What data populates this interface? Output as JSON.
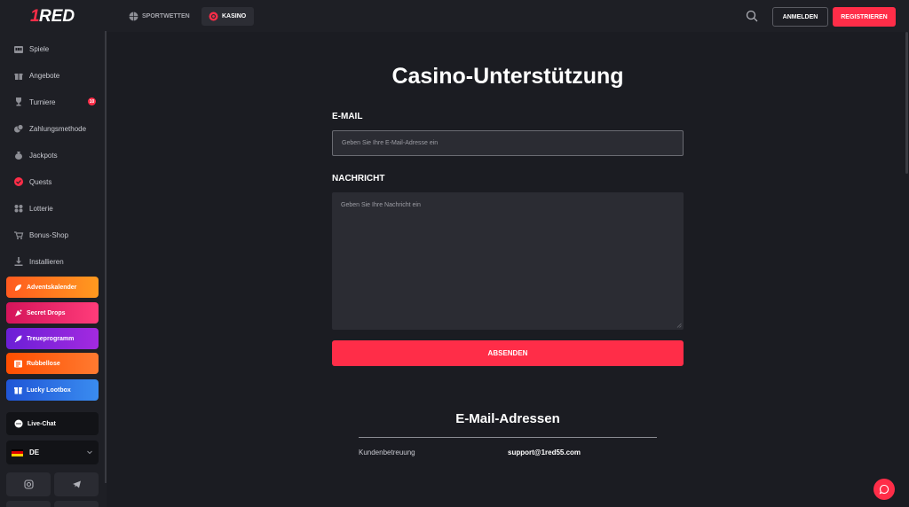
{
  "brand": {
    "logo_text": "1RED",
    "accent": "#ff2d48"
  },
  "sidebar": {
    "items": [
      {
        "label": "Spiele",
        "icon": "slots-icon"
      },
      {
        "label": "Angebote",
        "icon": "gift-icon"
      },
      {
        "label": "Turniere",
        "icon": "trophy-icon",
        "badge": "10"
      },
      {
        "label": "Zahlungsmethode",
        "icon": "coins-icon"
      },
      {
        "label": "Jackpots",
        "icon": "money-bag-icon"
      },
      {
        "label": "Quests",
        "icon": "quests-icon"
      },
      {
        "label": "Lotterie",
        "icon": "lottery-icon"
      },
      {
        "label": "Bonus-Shop",
        "icon": "shop-icon"
      },
      {
        "label": "Installieren",
        "icon": "download-icon"
      }
    ],
    "promos": [
      {
        "label": "Adventskalender",
        "icon": "leaf-icon"
      },
      {
        "label": "Secret Drops",
        "icon": "confetti-icon"
      },
      {
        "label": "Treueprogramm",
        "icon": "rocket-icon"
      },
      {
        "label": "Rubbellose",
        "icon": "scratch-card-icon"
      },
      {
        "label": "Lucky Lootbox",
        "icon": "lootbox-icon"
      }
    ],
    "live_chat": "Live-Chat",
    "language": "DE"
  },
  "topbar": {
    "tabs": [
      {
        "label": "SPORTWETTEN",
        "icon": "basketball-icon"
      },
      {
        "label": "KASINO",
        "icon": "casino-chip-icon"
      }
    ],
    "login": "ANMELDEN",
    "register": "REGISTRIEREN"
  },
  "main": {
    "title": "Casino-Unterstützung",
    "email_label": "E-MAIL",
    "email_placeholder": "Geben Sie Ihre E-Mail-Adresse ein",
    "message_label": "NACHRICHT",
    "message_placeholder": "Geben Sie Ihre Nachricht ein",
    "submit": "ABSENDEN",
    "emails_title": "E-Mail-Adressen",
    "emails": [
      {
        "label": "Kundenbetreuung",
        "value": "support@1red55.com"
      }
    ]
  }
}
